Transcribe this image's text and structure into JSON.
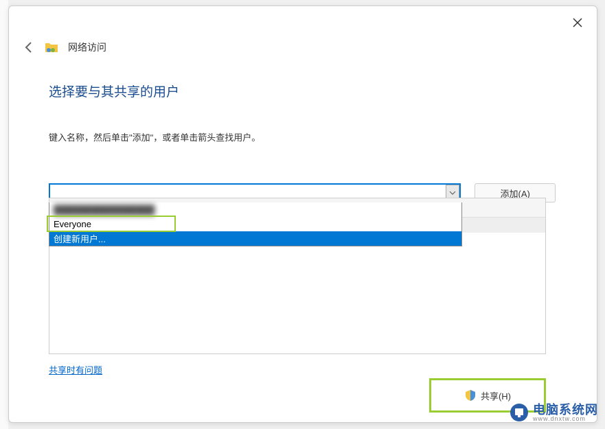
{
  "header": {
    "title": "网络访问"
  },
  "main": {
    "title": "选择要与其共享的用户",
    "subtitle": "键入名称，然后单击\"添加\"，或者单击箭头查找用户。"
  },
  "combo": {
    "value": "",
    "add_button": "添加(A)"
  },
  "dropdown": {
    "items": [
      {
        "label": "████████████████",
        "type": "blurred"
      },
      {
        "label": "Everyone",
        "type": "highlighted"
      },
      {
        "label": "创建新用户...",
        "type": "selected"
      }
    ]
  },
  "help_link": "共享时有问题",
  "footer": {
    "share_button": "共享(H)"
  },
  "watermark": {
    "text": "电脑系统网",
    "url": "www.dnxtw.com"
  }
}
